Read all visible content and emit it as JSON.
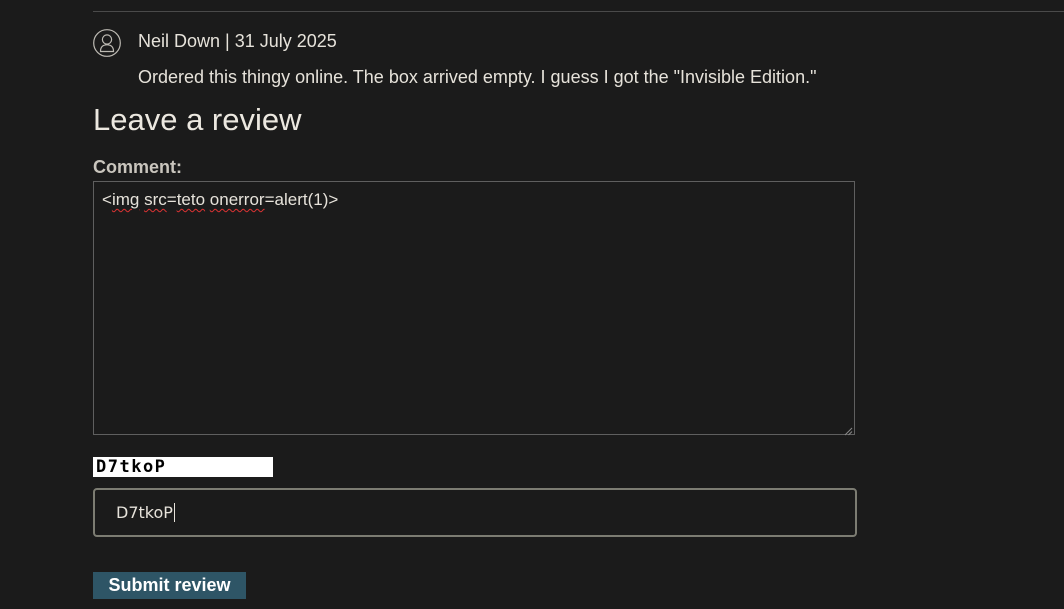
{
  "review": {
    "author": "Neil Down",
    "separator": "|",
    "date": "31 July 2025",
    "author_line": "Neil Down | 31 July 2025",
    "text": "Ordered this thingy online. The box arrived empty. I guess I got the \"Invisible Edition.\"",
    "avatar_icon": "user-avatar-icon"
  },
  "form": {
    "heading": "Leave a review",
    "comment_label": "Comment:",
    "comment_value": {
      "p1": "<",
      "p2": "img",
      "p3": " ",
      "p4": "src",
      "p5": "=",
      "p6": "teto",
      "p7": " ",
      "p8": "onerror",
      "p9": "=alert(1)>"
    },
    "captcha_image_text": "D7tkoP",
    "captcha_value": "D7tkoP",
    "submit_label": "Submit review"
  },
  "colors": {
    "background": "#1b1b1b",
    "text": "#e6e2da",
    "button": "#2e5566",
    "spellcheck": "#d33"
  }
}
